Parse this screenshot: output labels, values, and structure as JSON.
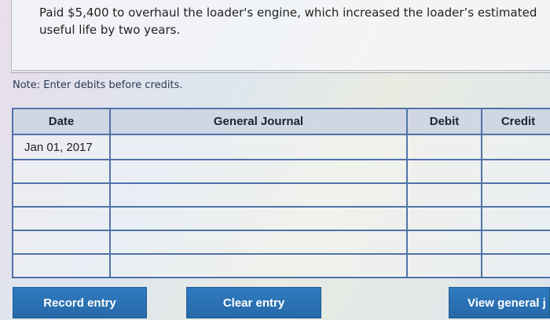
{
  "question": {
    "text": "Paid $5,400 to overhaul the loader's engine, which increased the loader’s estimated useful life by two years."
  },
  "note": "Note: Enter debits before credits.",
  "journal": {
    "headers": {
      "date": "Date",
      "general_journal": "General Journal",
      "debit": "Debit",
      "credit": "Credit"
    },
    "rows": [
      {
        "date": "Jan 01, 2017",
        "account": "",
        "debit": "",
        "credit": ""
      },
      {
        "date": "",
        "account": "",
        "debit": "",
        "credit": ""
      },
      {
        "date": "",
        "account": "",
        "debit": "",
        "credit": ""
      },
      {
        "date": "",
        "account": "",
        "debit": "",
        "credit": ""
      },
      {
        "date": "",
        "account": "",
        "debit": "",
        "credit": ""
      },
      {
        "date": "",
        "account": "",
        "debit": "",
        "credit": ""
      }
    ]
  },
  "buttons": {
    "record": "Record entry",
    "clear": "Clear entry",
    "view": "View general j"
  },
  "colors": {
    "button_blue": "#2b71b3",
    "table_border": "#4f73a8",
    "note_text": "#2b3a55"
  }
}
